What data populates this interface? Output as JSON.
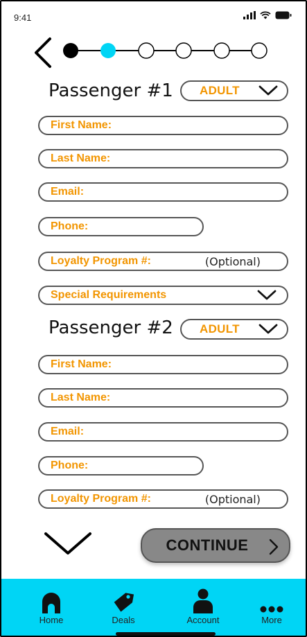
{
  "status_bar": {
    "time": "9:41"
  },
  "progress": {
    "total_steps": 6,
    "completed_steps": 1,
    "current_step": 2
  },
  "passengers": [
    {
      "title": "Passenger #1",
      "type": "ADULT",
      "fields": {
        "first_name": "First Name:",
        "last_name": "Last Name:",
        "email": "Email:",
        "phone": "Phone:",
        "loyalty": "Loyalty Program #:",
        "loyalty_hint": "(Optional)",
        "special": "Special Requirements"
      }
    },
    {
      "title": "Passenger #2",
      "type": "ADULT",
      "fields": {
        "first_name": "First Name:",
        "last_name": "Last Name:",
        "email": "Email:",
        "phone": "Phone:",
        "loyalty": "Loyalty Program #:",
        "loyalty_hint": "(Optional)"
      }
    }
  ],
  "actions": {
    "continue_label": "CONTINUE"
  },
  "tabbar": {
    "items": [
      {
        "label": "Home",
        "icon": "home-icon"
      },
      {
        "label": "Deals",
        "icon": "tag-icon"
      },
      {
        "label": "Account",
        "icon": "person-icon"
      },
      {
        "label": "More",
        "icon": "more-dots-icon"
      }
    ]
  },
  "colors": {
    "accent_orange": "#f29500",
    "step_current": "#00d5f5",
    "tabbar_bg": "#00d5f5",
    "continue_bg": "#888888"
  }
}
